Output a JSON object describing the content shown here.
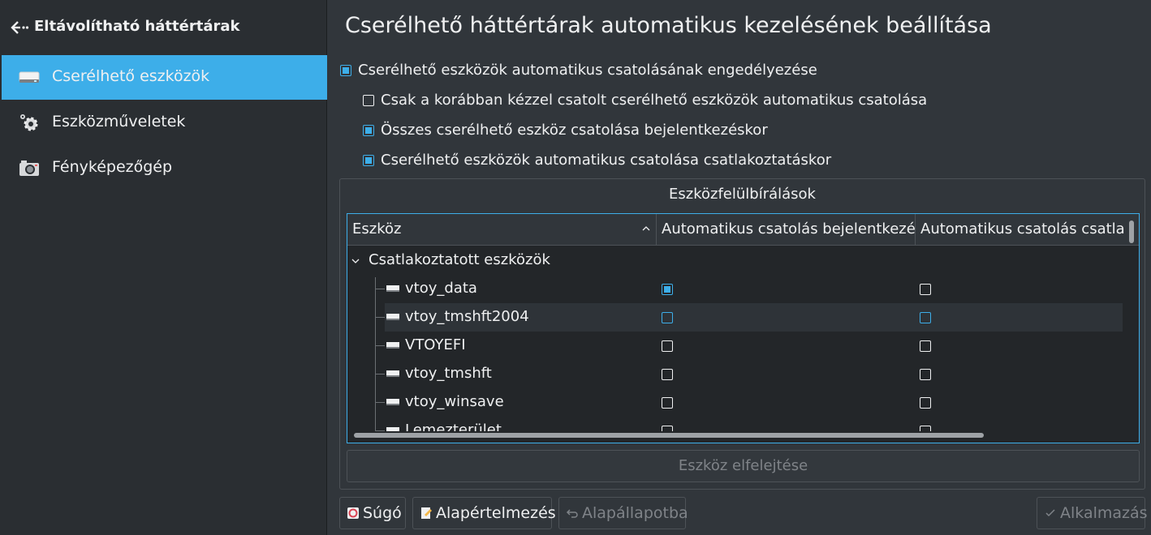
{
  "sidebar": {
    "header_title": "Eltávolítható háttértárak",
    "items": [
      {
        "label": "Cserélhető eszközök",
        "icon": "drive-icon",
        "active": true
      },
      {
        "label": "Eszközműveletek",
        "icon": "gear-icon",
        "active": false
      },
      {
        "label": "Fényképezőgép",
        "icon": "camera-icon",
        "active": false
      }
    ]
  },
  "main": {
    "title": "Cserélhető háttértárak automatikus kezelésének beállítása",
    "options": [
      {
        "label": "Cserélhető eszközök automatikus csatolásának engedélyezése",
        "checked": true
      },
      {
        "label": "Csak a korábban kézzel csatolt cserélhető eszközök automatikus csatolása",
        "checked": false
      },
      {
        "label": "Összes cserélhető eszköz csatolása bejelentkezéskor",
        "checked": true
      },
      {
        "label": "Cserélhető eszközök automatikus csatolása csatlakoztatáskor",
        "checked": true
      }
    ],
    "group_title": "Eszközfelülbírálások",
    "columns": [
      "Eszköz",
      "Automatikus csatolás bejelentkezé",
      "Automatikus csatolás csatlak"
    ],
    "tree_group": "Csatlakoztatott eszközök",
    "devices": [
      {
        "name": "vtoy_data",
        "login": true,
        "attach": false
      },
      {
        "name": "vtoy_tmshft2004",
        "login": false,
        "attach": false
      },
      {
        "name": "VTOYEFI",
        "login": false,
        "attach": false
      },
      {
        "name": "vtoy_tmshft",
        "login": false,
        "attach": false
      },
      {
        "name": "vtoy_winsave",
        "login": false,
        "attach": false
      },
      {
        "name": "Lemezterület",
        "login": false,
        "attach": false
      }
    ],
    "forget_button": "Eszköz elfelejtése"
  },
  "footer": {
    "help": "Súgó",
    "defaults": "Alapértelmezés",
    "reset": "Alapállapotba",
    "apply": "Alkalmazás"
  },
  "colors": {
    "accent": "#3daee9",
    "background": "#31363b",
    "sidebar": "#2a2e32"
  }
}
